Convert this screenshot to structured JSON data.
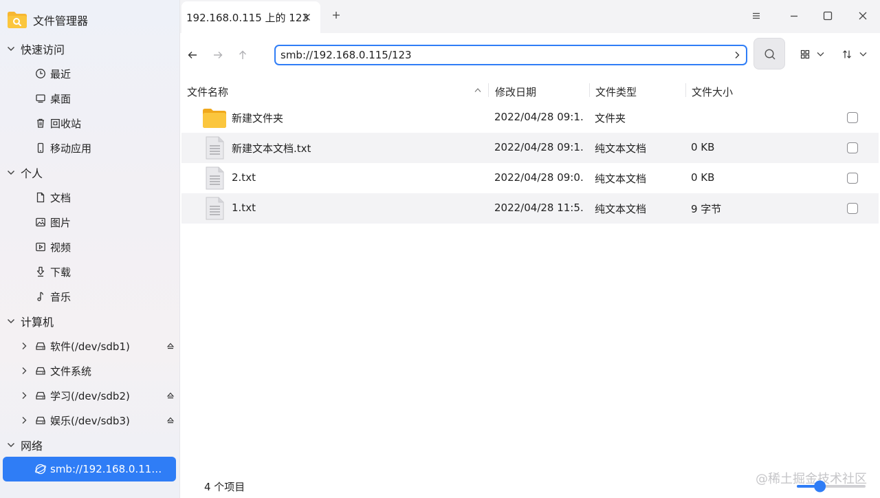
{
  "app": {
    "title": "文件管理器"
  },
  "tabs": [
    {
      "label": "192.168.0.115 上的 123"
    }
  ],
  "address": {
    "value": "smb://192.168.0.115/123"
  },
  "sidebar": {
    "groups": [
      {
        "label": "快速访问",
        "items": [
          {
            "label": "最近",
            "icon": "clock-icon"
          },
          {
            "label": "桌面",
            "icon": "desktop-icon"
          },
          {
            "label": "回收站",
            "icon": "trash-icon"
          },
          {
            "label": "移动应用",
            "icon": "phone-icon"
          }
        ]
      },
      {
        "label": "个人",
        "items": [
          {
            "label": "文档",
            "icon": "document-icon"
          },
          {
            "label": "图片",
            "icon": "image-icon"
          },
          {
            "label": "视频",
            "icon": "video-icon"
          },
          {
            "label": "下载",
            "icon": "download-icon"
          },
          {
            "label": "音乐",
            "icon": "music-icon"
          }
        ]
      },
      {
        "label": "计算机",
        "items": [
          {
            "label": "软件(/dev/sdb1)",
            "icon": "disk-icon"
          },
          {
            "label": "文件系统",
            "icon": "disk-icon"
          },
          {
            "label": "学习(/dev/sdb2)",
            "icon": "disk-icon"
          },
          {
            "label": "娱乐(/dev/sdb3)",
            "icon": "disk-icon"
          }
        ]
      },
      {
        "label": "网络",
        "items": [
          {
            "label": "smb://192.168.0.11…",
            "icon": "network-share-icon",
            "active": true
          }
        ]
      }
    ]
  },
  "columns": {
    "name": "文件名称",
    "modified": "修改日期",
    "type": "文件类型",
    "size": "文件大小"
  },
  "files": [
    {
      "name": "新建文件夹",
      "modified": "2022/04/28 09:1…",
      "type": "文件夹",
      "size": "",
      "icon": "folder-icon"
    },
    {
      "name": "新建文本文档.txt",
      "modified": "2022/04/28 09:1…",
      "type": "纯文本文档",
      "size": "0 KB",
      "icon": "text-file-icon"
    },
    {
      "name": "2.txt",
      "modified": "2022/04/28 09:0…",
      "type": "纯文本文档",
      "size": "0 KB",
      "icon": "text-file-icon"
    },
    {
      "name": "1.txt",
      "modified": "2022/04/28 11:5…",
      "type": "纯文本文档",
      "size": "9 字节",
      "icon": "text-file-icon"
    }
  ],
  "status": {
    "count": "4 个项目"
  },
  "zoom": {
    "level": 0.3
  },
  "watermark": "@稀土掘金技术社区",
  "colors": {
    "accent": "#2f7df6",
    "folder": "#f7b731"
  }
}
